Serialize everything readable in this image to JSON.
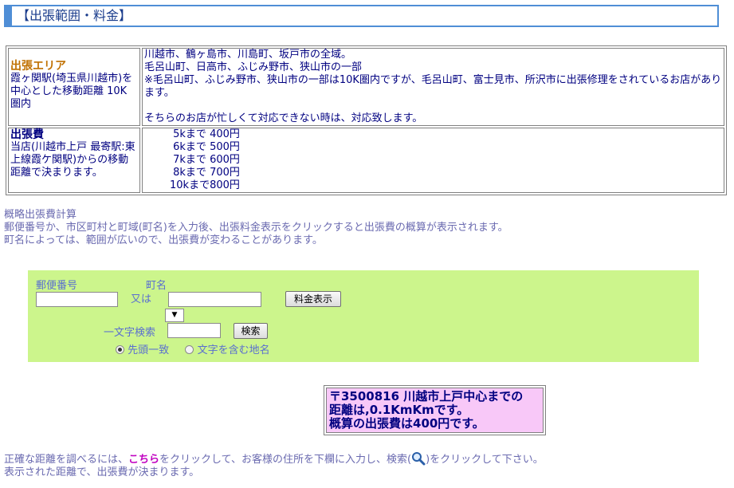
{
  "header": {
    "title": "【出張範囲・料金】"
  },
  "area": {
    "title": "出張エリア",
    "left_desc": "霞ヶ関駅(埼玉県川越市)を中心とした移動距離 10K 圏内",
    "lines": [
      "川越市、鶴ヶ島市、川島町、坂戸市の全域。",
      "毛呂山町、日高市、ふじみ野市、狭山市の一部",
      "※毛呂山町、ふじみ野市、狭山市の一部は10K圏内ですが、毛呂山町、富士見市、所沢市に出張修理をされているお店があります。",
      "",
      "そちらのお店が忙しくて対応できない時は、対応致します。"
    ]
  },
  "fee": {
    "title": "出張費",
    "left_desc": "当店(川越市上戸 最寄駅:東上線霞ケ関駅)からの移動距離で決まります。",
    "rows": [
      " 5kまで 400円",
      " 6kまで 500円",
      " 7kまで 600円",
      " 8kまで 700円",
      "10kまで800円"
    ]
  },
  "calc": {
    "heading": "概略出張費計算",
    "desc1": "郵便番号か、市区町村と町域(町名)を入力後、出張料金表示をクリックすると出張費の概算が表示されます。",
    "desc2": "町名によっては、範囲が広いので、出張費が変わることがあります。",
    "postal_label": "郵便番号",
    "or_label": "又は",
    "town_label": "町名",
    "postal_value": "",
    "town_value": "",
    "fee_button": "料金表示",
    "select_value": "▼",
    "char_search_label": "一文字検索",
    "char_search_value": "",
    "search_button": "検索",
    "radio_prefix": "先頭一致",
    "radio_contains": "文字を含む地名"
  },
  "result": {
    "line1": "〒3500816 川越市上戸中心までの",
    "line2": "距離は,0.1KmKmです。",
    "line3": "概算の出張費は400円です。"
  },
  "footer": {
    "text_before": "正確な距離を調べるには、",
    "link": "こちら",
    "text_middle": "をクリックして、お客様の住所を下欄に入力し、検索(",
    "text_after": ")をクリックして下さい。",
    "line2": "表示された距離で、出張費が決まります。",
    "icon": "magnifier-icon"
  }
}
